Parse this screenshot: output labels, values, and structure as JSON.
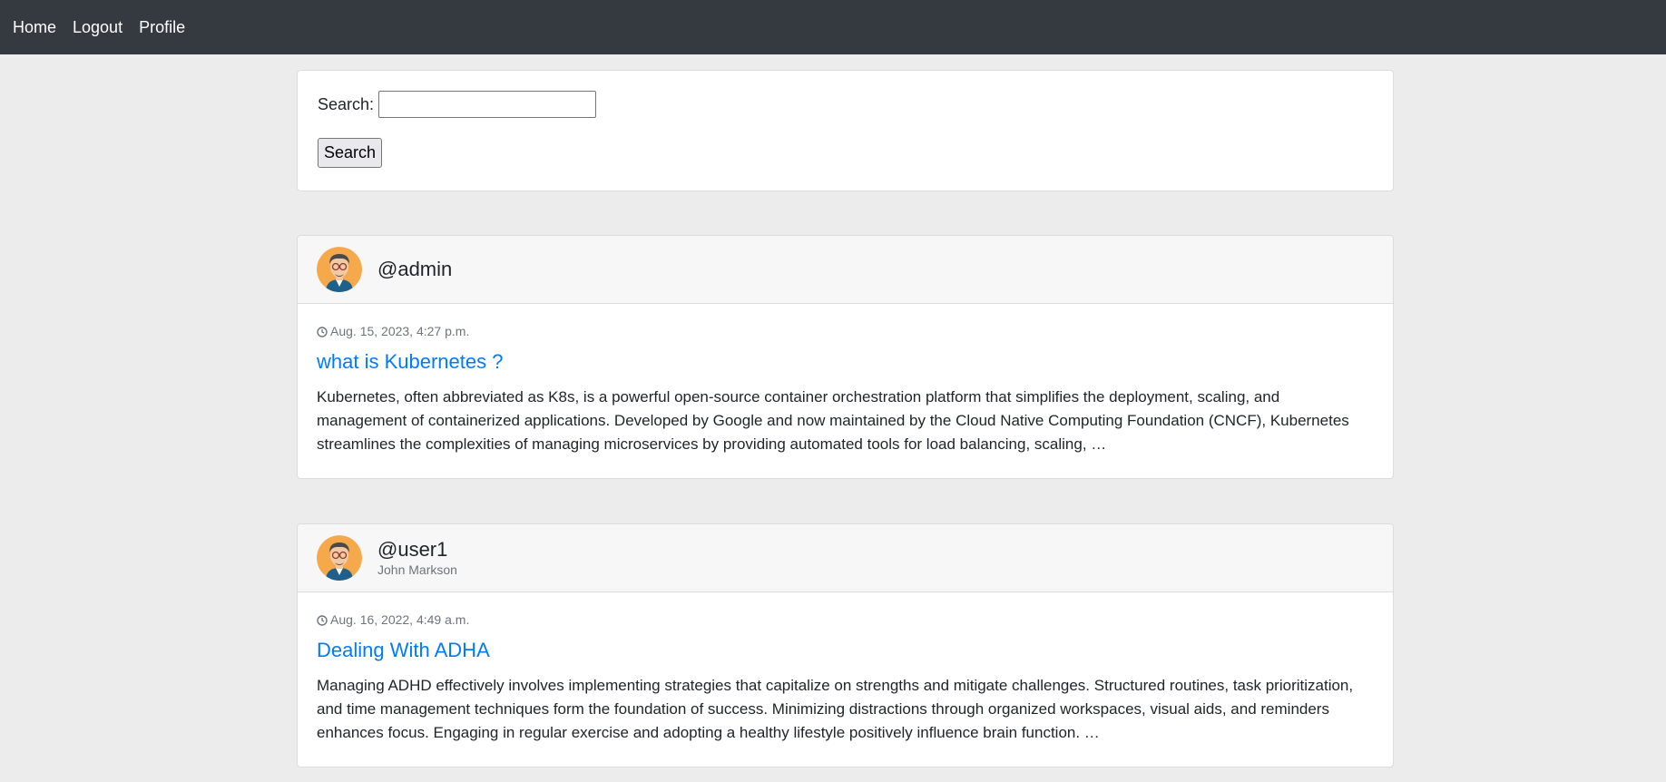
{
  "nav": {
    "items": [
      "Home",
      "Logout",
      "Profile"
    ]
  },
  "search": {
    "label": "Search:",
    "value": "",
    "button_label": "Search"
  },
  "posts": [
    {
      "username": "@admin",
      "fullname": "",
      "date": "Aug. 15, 2023, 4:27 p.m.",
      "title": "what is Kubernetes ?",
      "excerpt": "Kubernetes, often abbreviated as K8s, is a powerful open-source container orchestration platform that simplifies the deployment, scaling, and management of containerized applications. Developed by Google and now maintained by the Cloud Native Computing Foundation (CNCF), Kubernetes streamlines the complexities of managing microservices by providing automated tools for load balancing, scaling, …"
    },
    {
      "username": "@user1",
      "fullname": "John Markson",
      "date": "Aug. 16, 2022, 4:49 a.m.",
      "title": "Dealing With ADHA",
      "excerpt": "Managing ADHD effectively involves implementing strategies that capitalize on strengths and mitigate challenges. Structured routines, task prioritization, and time management techniques form the foundation of success. Minimizing distractions through organized workspaces, visual aids, and reminders enhances focus. Engaging in regular exercise and adopting a healthy lifestyle positively influence brain function. …"
    }
  ],
  "colors": {
    "navbar": "#343a40",
    "link": "#007bff",
    "muted": "#6c757d",
    "background": "#ececec"
  },
  "icons": {
    "date": "clock-icon",
    "avatar": "avatar-icon"
  }
}
